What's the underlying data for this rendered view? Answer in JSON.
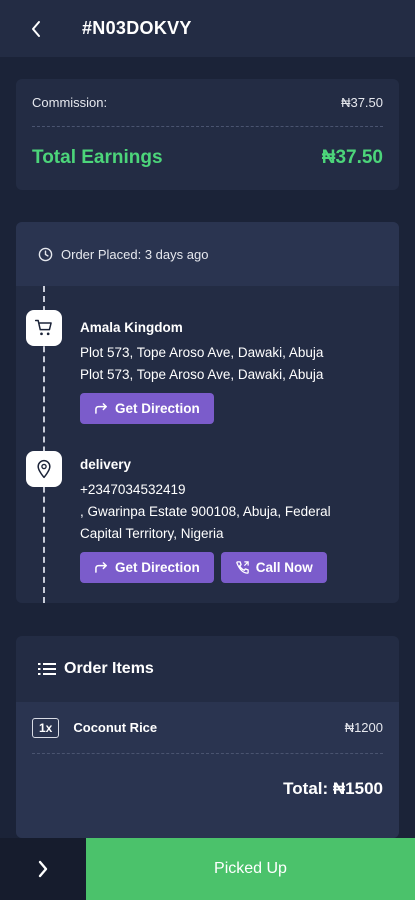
{
  "header": {
    "title": "#N03DOKVY",
    "back_icon": "chevron-left-icon"
  },
  "earnings": {
    "commission_label": "Commission:",
    "commission_value": "₦37.50",
    "total_label": "Total Earnings",
    "total_value": "₦37.50",
    "accent_color": "#4cd57a"
  },
  "order": {
    "placed_text": "Order Placed: 3 days ago",
    "pickup": {
      "icon": "cart-icon",
      "name": "Amala Kingdom",
      "address_line1": "Plot 573, Tope Aroso Ave, Dawaki, Abuja",
      "address_line2": "Plot 573, Tope Aroso Ave, Dawaki, Abuja",
      "direction_label": "Get Direction"
    },
    "delivery": {
      "icon": "map-pin-icon",
      "name": "delivery",
      "phone": "+2347034532419",
      "address_line1": ", Gwarinpa Estate 900108, Abuja, Federal",
      "address_line2": "Capital Territory, Nigeria",
      "direction_label": "Get Direction",
      "call_label": "Call Now"
    },
    "button_color": "#7b5ccb"
  },
  "items": {
    "title": "Order Items",
    "list": [
      {
        "qty": "1x",
        "name": "Coconut Rice",
        "price": "₦1200"
      }
    ],
    "total": "Total: ₦1500"
  },
  "bottom": {
    "next_icon": "chevron-right-icon",
    "action_label": "Picked Up",
    "action_color": "#4bc26b"
  }
}
